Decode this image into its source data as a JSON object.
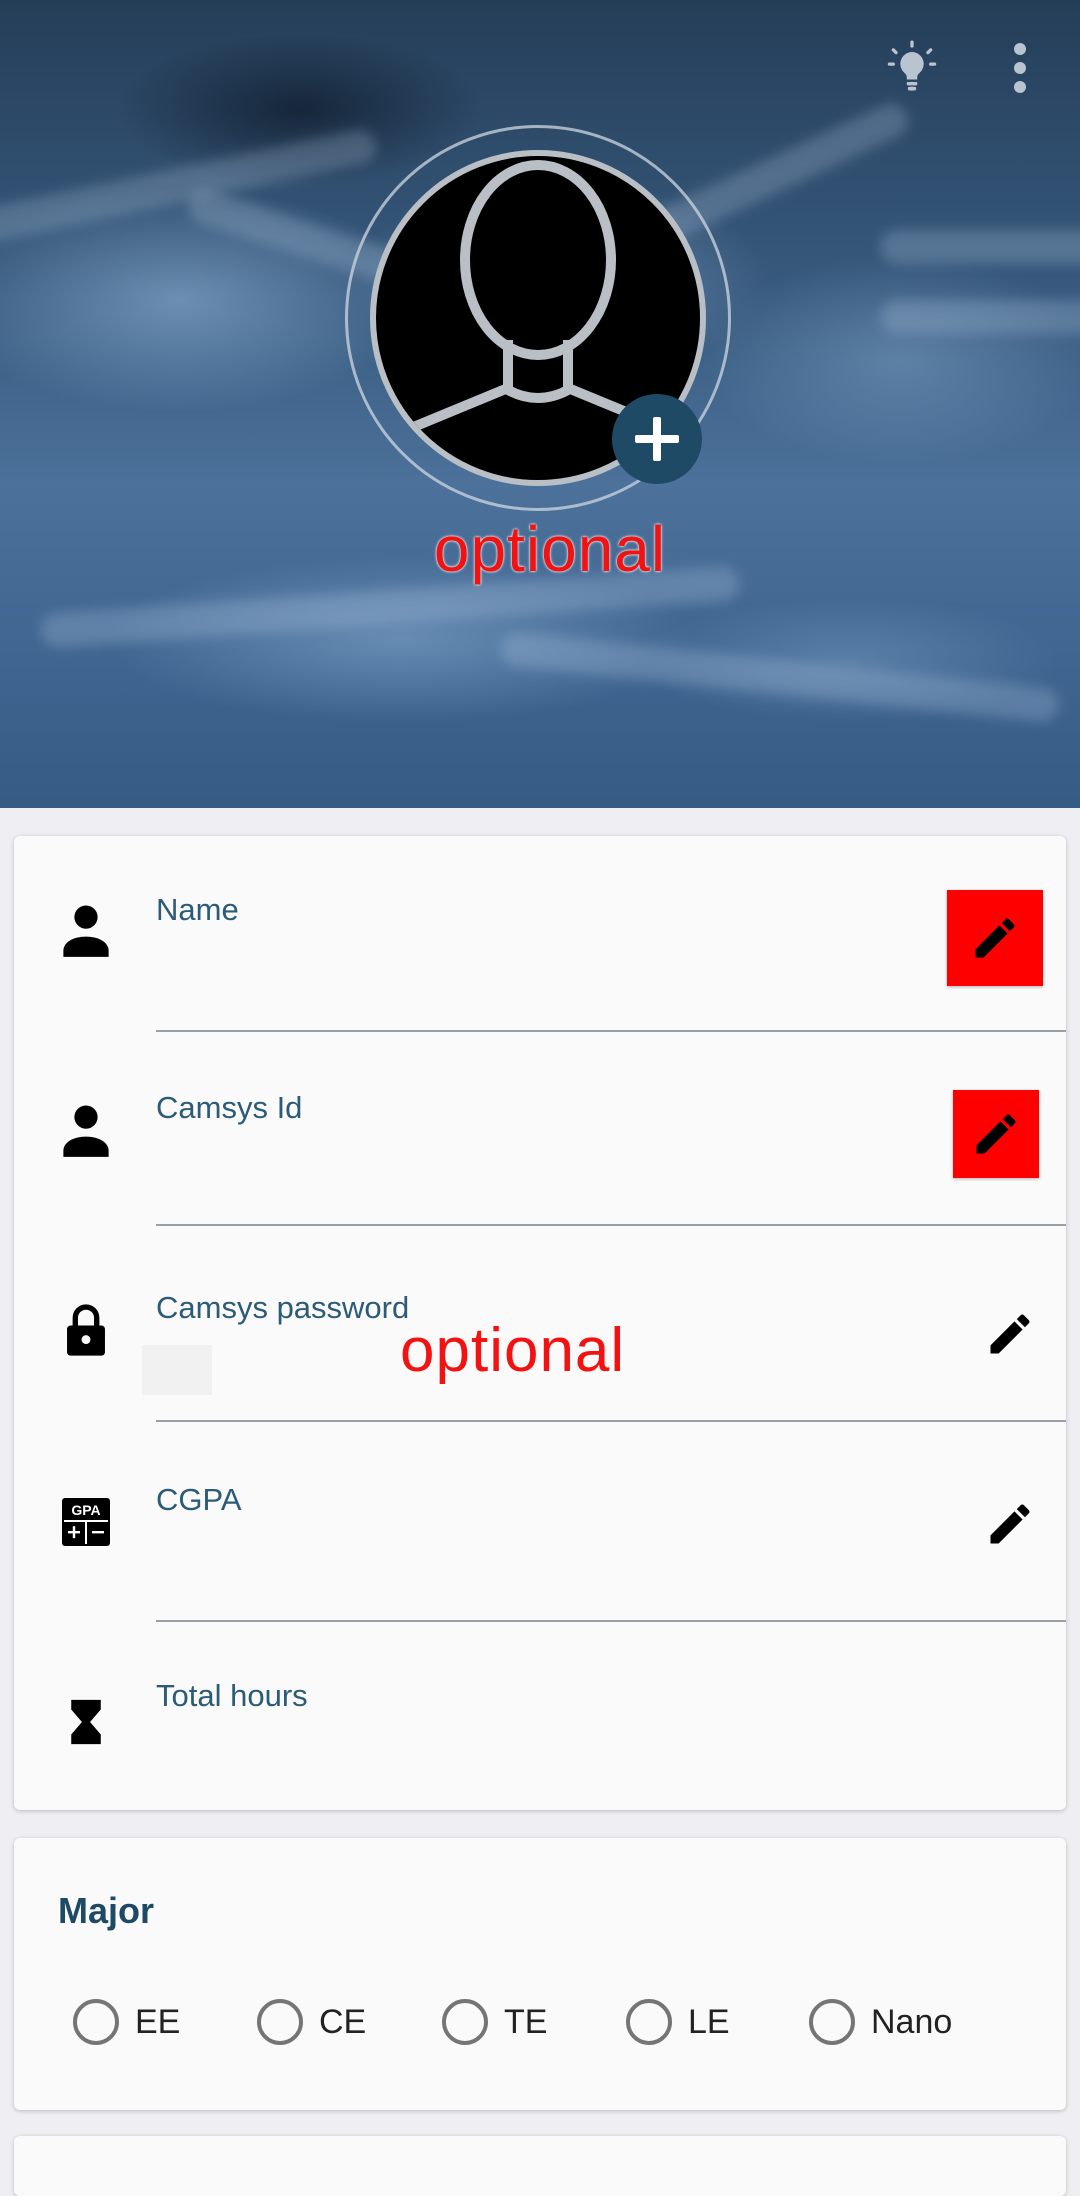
{
  "header": {
    "icons": {
      "theme": "lightbulb-icon",
      "menu": "more-vert-icon",
      "add_photo": "plus-icon"
    },
    "avatar_annotation": "optional"
  },
  "fields": [
    {
      "label": "Name",
      "icon": "person-icon",
      "value": "",
      "edit_icon": "pencil-icon",
      "edit_highlight": "#ff0000"
    },
    {
      "label": "Camsys Id",
      "icon": "person-icon",
      "value": "",
      "edit_icon": "pencil-icon",
      "edit_highlight": "#ff0000"
    },
    {
      "label": "Camsys password",
      "icon": "lock-icon",
      "value": "",
      "edit_icon": "pencil-icon",
      "annotation": "optional"
    },
    {
      "label": "CGPA",
      "icon": "gpa-calculator-icon",
      "icon_text": "GPA",
      "value": "",
      "edit_icon": "pencil-icon"
    },
    {
      "label": "Total hours",
      "icon": "hourglass-icon",
      "value": ""
    }
  ],
  "major": {
    "title": "Major",
    "options": [
      "EE",
      "CE",
      "TE",
      "LE",
      "Nano"
    ],
    "selected": null
  },
  "colors": {
    "accent": "#1f4a66",
    "label": "#2c5b78",
    "annotation": "#f21212"
  }
}
